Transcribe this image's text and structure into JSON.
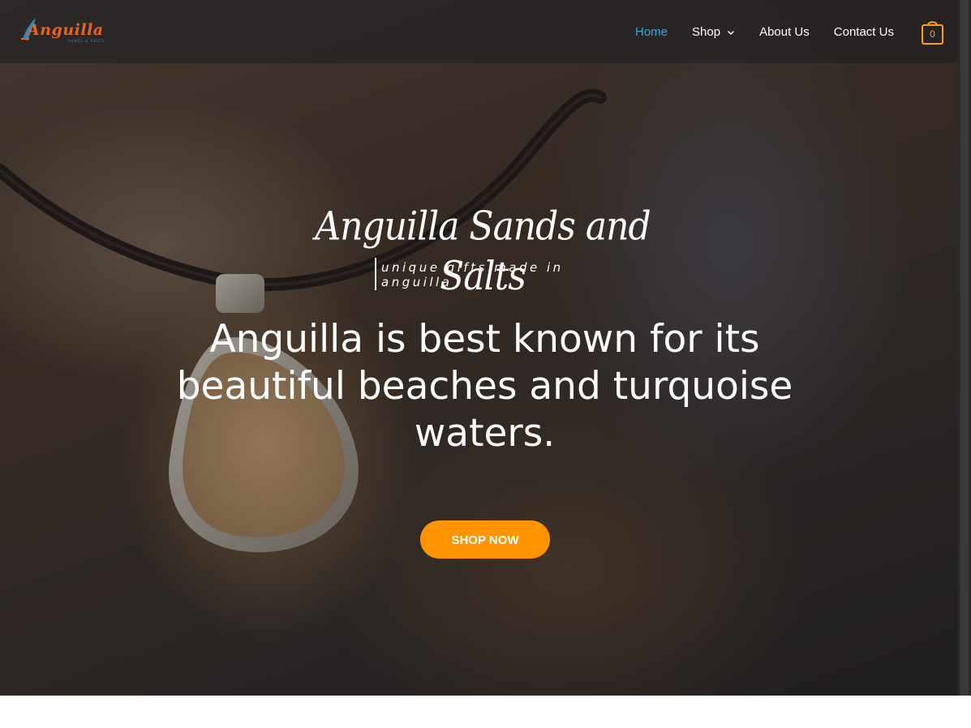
{
  "header": {
    "logo": {
      "text": "Anguilla",
      "subtext": "SANDS & SALTS"
    },
    "nav": {
      "items": [
        {
          "label": "Home",
          "active": true
        },
        {
          "label": "Shop",
          "has_dropdown": true
        },
        {
          "label": "About Us"
        },
        {
          "label": "Contact Us"
        }
      ]
    },
    "cart": {
      "count": "0"
    }
  },
  "hero": {
    "brand_title": "Anguilla Sands and Salts",
    "brand_tagline": "unique gifts made in anguilla",
    "headline": "Anguilla is best known for its beautiful beaches and turquoise waters.",
    "cta_label": "SHOP NOW"
  },
  "colors": {
    "accent": "#ff9300",
    "nav_active": "#35a7dd",
    "logo_orange": "#e2661d",
    "logo_blue": "#2b87c5"
  },
  "icons": {
    "cart": "shopping-bag-icon",
    "dropdown": "chevron-down-icon"
  }
}
